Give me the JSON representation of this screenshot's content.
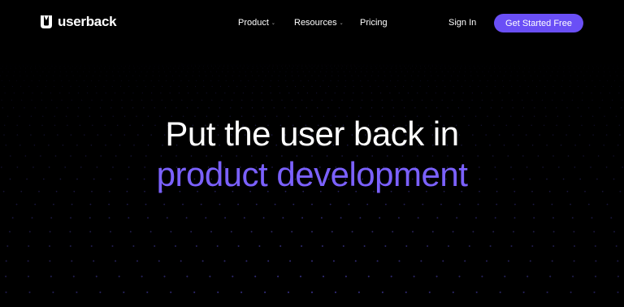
{
  "colors": {
    "background": "#000000",
    "accent": "#6a4ff6",
    "heading_accent": "#7b61ff",
    "dots": "#5a4fd8"
  },
  "brand": {
    "name": "userback",
    "icon": "userback-logo-icon"
  },
  "nav": {
    "items": [
      {
        "label": "Product",
        "has_dropdown": true
      },
      {
        "label": "Resources",
        "has_dropdown": true
      },
      {
        "label": "Pricing",
        "has_dropdown": false
      }
    ],
    "sign_in": "Sign In",
    "cta": "Get Started Free"
  },
  "hero": {
    "line1": "Put the user back in",
    "line2": "product development"
  }
}
